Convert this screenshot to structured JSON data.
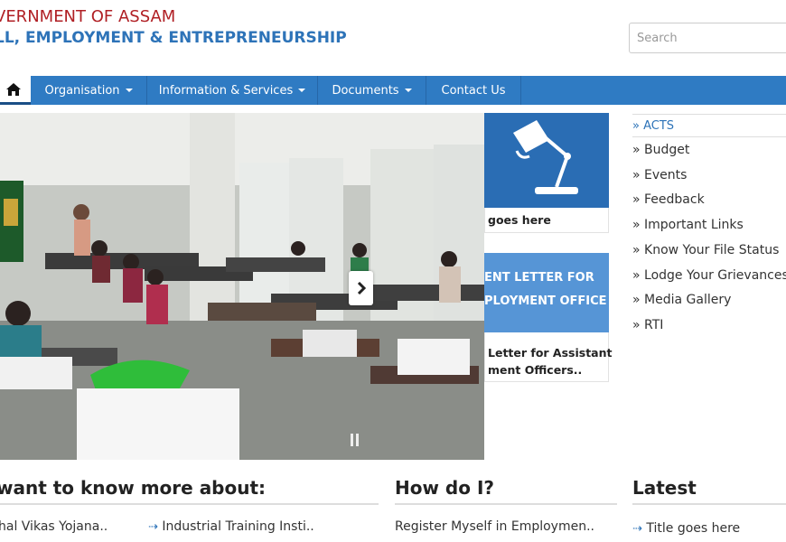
{
  "header": {
    "line1": "VERNMENT OF ASSAM",
    "line2": "LL, EMPLOYMENT & ENTREPRENEURSHIP"
  },
  "search": {
    "placeholder": "Search"
  },
  "nav": {
    "home_icon": "home-icon",
    "items": [
      {
        "label": "Organisation",
        "dropdown": true
      },
      {
        "label": "Information & Services",
        "dropdown": true
      },
      {
        "label": "Documents",
        "dropdown": true
      },
      {
        "label": "Contact Us",
        "dropdown": false
      }
    ]
  },
  "cards": {
    "card1_caption": "goes here",
    "card2_banner_line1": "ENT  LETTER FOR",
    "card2_banner_line2": "PLOYMENT OFFICER",
    "card2_caption_line1": "Letter for Assistant",
    "card2_caption_line2": "ment Officers.."
  },
  "sidebar": {
    "items": [
      "» ACTS",
      "» Budget",
      "» Events",
      "» Feedback",
      "» Important Links",
      "» Know Your File Status",
      "» Lodge Your Grievances",
      "» Media Gallery",
      "» RTI"
    ]
  },
  "sections": {
    "know_more": {
      "heading": "want to know more about:",
      "links": [
        "hal Vikas Yojana..",
        "Industrial Training Insti.."
      ]
    },
    "how_do_i": {
      "heading": "How do I?",
      "links": [
        "Register Myself in Employmen.."
      ]
    },
    "latest": {
      "heading": "Latest",
      "links": [
        "Title goes here"
      ]
    }
  },
  "colors": {
    "nav_blue": "#2f7bc3",
    "header_red": "#b01f24",
    "header_blue": "#2d73b8"
  }
}
